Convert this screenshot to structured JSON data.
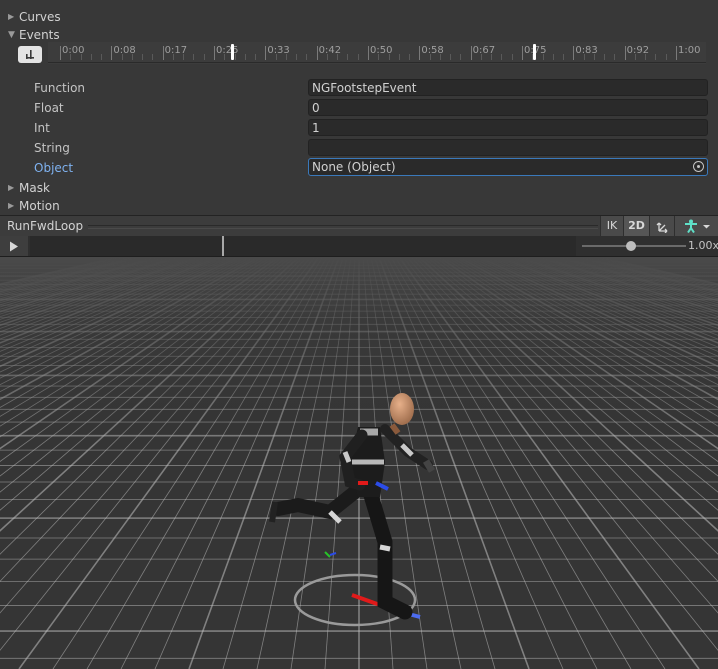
{
  "sections": {
    "curves": "Curves",
    "events": "Events",
    "mask": "Mask",
    "motion": "Motion"
  },
  "timeline": {
    "labels": [
      "0:00",
      "0:08",
      "0:17",
      "0:25",
      "0:33",
      "0:42",
      "0:50",
      "0:58",
      "0:67",
      "0:75",
      "0:83",
      "0:92",
      "1:00"
    ],
    "markers": [
      {
        "time": 0.28,
        "color": "#ffffff"
      },
      {
        "time": 0.77,
        "color": "#ffffff"
      }
    ]
  },
  "event_props": {
    "function": {
      "label": "Function",
      "value": "NGFootstepEvent"
    },
    "float": {
      "label": "Float",
      "value": "0"
    },
    "int": {
      "label": "Int",
      "value": "1"
    },
    "string": {
      "label": "String",
      "value": ""
    },
    "object": {
      "label": "Object",
      "value": "None (Object)"
    }
  },
  "preview": {
    "title": "RunFwdLoop",
    "ik_label": "IK",
    "twod_label": "2D",
    "speed": "1.00x",
    "playhead_fraction": 0.3
  },
  "colors": {
    "accent": "#7fb2f0",
    "focus_border": "#3a79bb",
    "axis_x": "#e11a1a",
    "axis_y": "#27c227",
    "axis_z": "#2b4ce8"
  },
  "icons": {
    "add_event": "add-event-icon",
    "object_picker": "object-picker-icon",
    "pivot": "pivot-icon",
    "avatar": "avatar-icon",
    "play": "play-icon"
  }
}
